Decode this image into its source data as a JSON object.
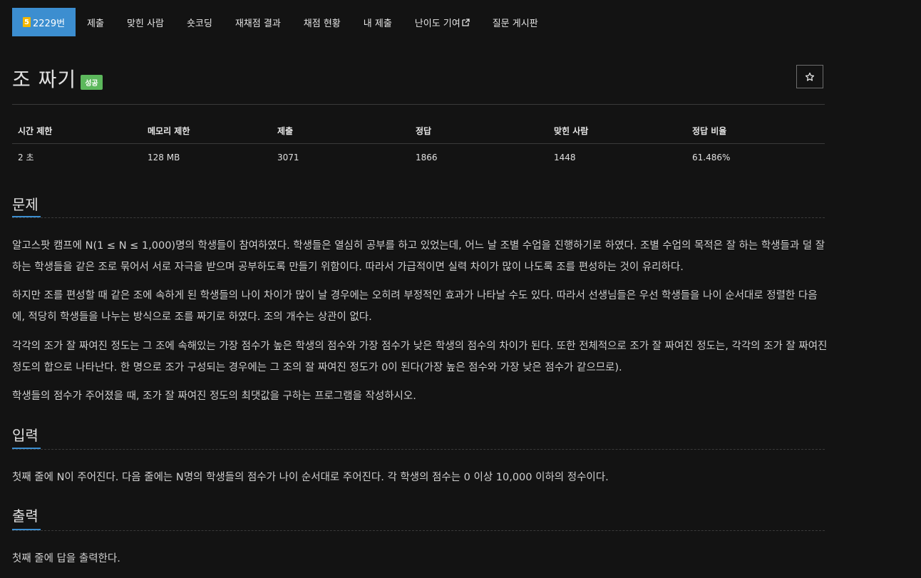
{
  "nav": {
    "problem_tier": "5",
    "problem_number": "2229번",
    "items": [
      "제출",
      "맞힌 사람",
      "숏코딩",
      "재채점 결과",
      "채점 현황",
      "내 제출",
      "난이도 기여",
      "질문 게시판"
    ],
    "tier_color": "#f5b800",
    "active_color": "#3c8ed0"
  },
  "problem": {
    "title": "조 짜기",
    "status_badge": "성공",
    "star_icon": "star-outline-icon"
  },
  "info_table": {
    "headers": [
      "시간 제한",
      "메모리 제한",
      "제출",
      "정답",
      "맞힌 사람",
      "정답 비율"
    ],
    "values": [
      "2 초",
      "128 MB",
      "3071",
      "1866",
      "1448",
      "61.486%"
    ]
  },
  "sections": {
    "problem_heading": "문제",
    "problem_paragraphs": [
      "알고스팟 캠프에 N(1 ≤ N ≤ 1,000)명의 학생들이 참여하였다. 학생들은 열심히 공부를 하고 있었는데, 어느 날 조별 수업을 진행하기로 하였다. 조별 수업의 목적은 잘 하는 학생들과 덜 잘 하는 학생들을 같은 조로 묶어서 서로 자극을 받으며 공부하도록 만들기 위함이다. 따라서 가급적이면 실력 차이가 많이 나도록 조를 편성하는 것이 유리하다.",
      "하지만 조를 편성할 때 같은 조에 속하게 된 학생들의 나이 차이가 많이 날 경우에는 오히려 부정적인 효과가 나타날 수도 있다. 따라서 선생님들은 우선 학생들을 나이 순서대로 정렬한 다음에, 적당히 학생들을 나누는 방식으로 조를 짜기로 하였다. 조의 개수는 상관이 없다.",
      "각각의 조가 잘 짜여진 정도는 그 조에 속해있는 가장 점수가 높은 학생의 점수와 가장 점수가 낮은 학생의 점수의 차이가 된다. 또한 전체적으로 조가 잘 짜여진 정도는, 각각의 조가 잘 짜여진 정도의 합으로 나타난다. 한 명으로 조가 구성되는 경우에는 그 조의 잘 짜여진 정도가 0이 된다(가장 높은 점수와 가장 낮은 점수가 같으므로).",
      "학생들의 점수가 주어졌을 때, 조가 잘 짜여진 정도의 최댓값을 구하는 프로그램을 작성하시오."
    ],
    "input_heading": "입력",
    "input_text": "첫째 줄에 N이 주어진다. 다음 줄에는 N명의 학생들의 점수가 나이 순서대로 주어진다. 각 학생의 점수는 0 이상 10,000 이하의 정수이다.",
    "output_heading": "출력",
    "output_text": "첫째 줄에 답을 출력한다."
  }
}
